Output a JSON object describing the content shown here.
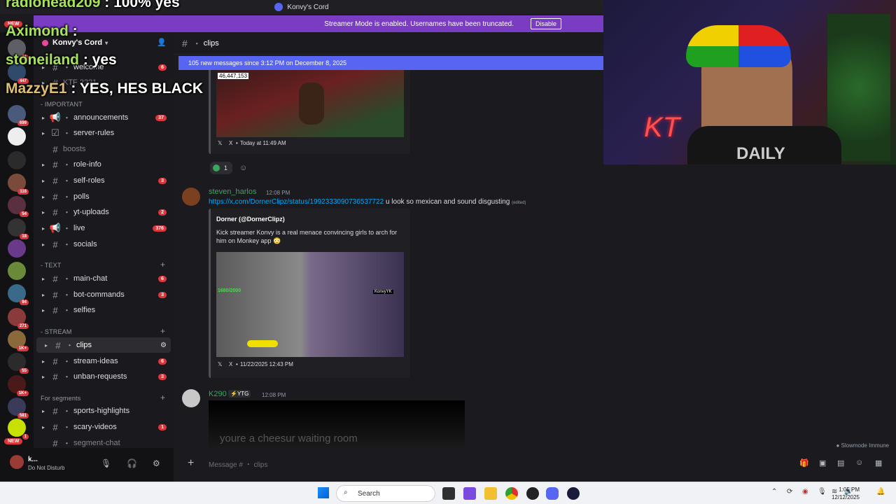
{
  "window": {
    "title": "Konvy's Cord"
  },
  "streamer_banner": {
    "text": "Streamer Mode is enabled. Usernames have been truncated.",
    "disable_label": "Disable"
  },
  "server": {
    "name": "Konvy's Cord"
  },
  "server_rail": {
    "new_top": "NEW",
    "new_bottom": "NEW",
    "badges": [
      "11",
      "447",
      "699",
      "116",
      "54",
      "18",
      "94",
      "271",
      "1K+",
      "55",
      "1K+",
      "581",
      "1"
    ]
  },
  "categories": {
    "important": "- IMPORTANT",
    "text": "- TEXT",
    "stream": "- STREAM",
    "segments": "For segments"
  },
  "channels": [
    {
      "name": "welcome",
      "badge": "6"
    },
    {
      "name": "KTF 2221",
      "badge": ""
    },
    {
      "name": "announcements",
      "badge": "37"
    },
    {
      "name": "server-rules",
      "badge": ""
    },
    {
      "name": "boosts",
      "badge": ""
    },
    {
      "name": "role-info",
      "badge": ""
    },
    {
      "name": "self-roles",
      "badge": "3"
    },
    {
      "name": "polls",
      "badge": ""
    },
    {
      "name": "yt-uploads",
      "badge": "2"
    },
    {
      "name": "live",
      "badge": "376"
    },
    {
      "name": "socials",
      "badge": ""
    },
    {
      "name": "main-chat",
      "badge": "6"
    },
    {
      "name": "bot-commands",
      "badge": "3"
    },
    {
      "name": "selfies",
      "badge": ""
    },
    {
      "name": "clips",
      "badge": ""
    },
    {
      "name": "stream-ideas",
      "badge": "6"
    },
    {
      "name": "unban-requests",
      "badge": "3"
    },
    {
      "name": "sports-highlights",
      "badge": ""
    },
    {
      "name": "scary-videos",
      "badge": "1"
    },
    {
      "name": "segment-chat",
      "badge": ""
    }
  ],
  "user_panel": {
    "name": "k...",
    "status": "Do Not Disturb"
  },
  "chat": {
    "channel": "clips",
    "new_messages_bar": "105 new messages since 3:12 PM on December 8, 2025",
    "embed1": {
      "overlay_count": "46,447,153",
      "source": "X",
      "time": "Today at 11:49 AM",
      "reaction_count": "1"
    },
    "message2": {
      "author": "steven_harlos",
      "time": "12:08 PM",
      "link": "https://x.com/DornerClipz/status/1992333090736537722",
      "text": " u look so mexican and sound disgusting",
      "edited": "(edited)",
      "embed_author": "Dorner (@DornerClipz)",
      "embed_text": "Kick streamer Konvy is a real menace convincing girls to arch for him on Monkey app 😳",
      "video_counter": "1680/2000",
      "video_tag": "KonvyYK",
      "source": "X",
      "date": "11/22/2025 12:43 PM"
    },
    "message3": {
      "author": "K290",
      "tag": "⚡YTG",
      "time": "12:08 PM",
      "video_caption": "youre a cheesur waiting room"
    }
  },
  "overlay_chat": [
    {
      "name": "radiohead209",
      "text": " : 100% yes"
    },
    {
      "name": "Aximond",
      "text": " : "
    },
    {
      "name": "stoneiland",
      "text": " : yes"
    },
    {
      "name": "MazzyE1",
      "text": " : YES, HES BLACK"
    }
  ],
  "composer": {
    "placeholder": "Message # ・ clips",
    "slowmode": "Slowmode Immune"
  },
  "taskbar": {
    "search": "Search",
    "time": "1:05 PM",
    "date": "12/12/2025"
  },
  "webcam": {
    "neon_text": "KT",
    "shirt_text": "DAILY"
  }
}
